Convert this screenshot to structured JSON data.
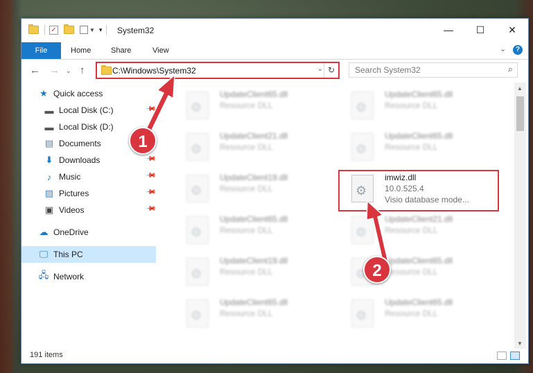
{
  "window": {
    "title": "System32"
  },
  "titlebar": {
    "minimize_glyph": "—",
    "maximize_glyph": "☐",
    "close_glyph": "✕"
  },
  "ribbon": {
    "file": "File",
    "home": "Home",
    "share": "Share",
    "view": "View",
    "expand_glyph": "⌄",
    "help_glyph": "?"
  },
  "address": {
    "path": "C:\\Windows\\System32",
    "search_placeholder": "Search System32"
  },
  "nav": {
    "items": [
      {
        "label": "Quick access",
        "icon": "star-icon"
      },
      {
        "label": "Local Disk (C:)",
        "icon": "drive-icon"
      },
      {
        "label": "Local Disk (D:)",
        "icon": "drive-icon"
      },
      {
        "label": "Documents",
        "icon": "documents-icon"
      },
      {
        "label": "Downloads",
        "icon": "download-icon"
      },
      {
        "label": "Music",
        "icon": "music-icon"
      },
      {
        "label": "Pictures",
        "icon": "pictures-icon"
      },
      {
        "label": "Videos",
        "icon": "video-icon"
      },
      {
        "label": "OneDrive",
        "icon": "cloud-icon"
      },
      {
        "label": "This PC",
        "icon": "computer-icon"
      },
      {
        "label": "Network",
        "icon": "network-icon"
      }
    ]
  },
  "files": [
    {
      "name": "UpdateClient65.dll",
      "type": "Resource DLL"
    },
    {
      "name": "UpdateClient65.dll",
      "type": "Resource DLL"
    },
    {
      "name": "UpdateClient21.dll",
      "type": "Resource DLL"
    },
    {
      "name": "UpdateClient65.dll",
      "type": "Resource DLL"
    },
    {
      "name": "UpdateClient19.dll",
      "type": "Resource DLL"
    },
    {
      "name": "imwiz.dll",
      "version": "10.0.525.4",
      "type": "Visio database mode..."
    },
    {
      "name": "UpdateClient65.dll",
      "type": "Resource DLL"
    },
    {
      "name": "UpdateClient21.dll",
      "type": "Resource DLL"
    },
    {
      "name": "UpdateClient19.dll",
      "type": "Resource DLL"
    },
    {
      "name": "UpdateClient65.dll",
      "type": "Resource DLL"
    },
    {
      "name": "UpdateClient65.dll",
      "type": "Resource DLL"
    },
    {
      "name": "UpdateClient65.dll",
      "type": "Resource DLL"
    }
  ],
  "status": {
    "count": "191 items"
  },
  "annotations": {
    "step1": "1",
    "step2": "2"
  }
}
